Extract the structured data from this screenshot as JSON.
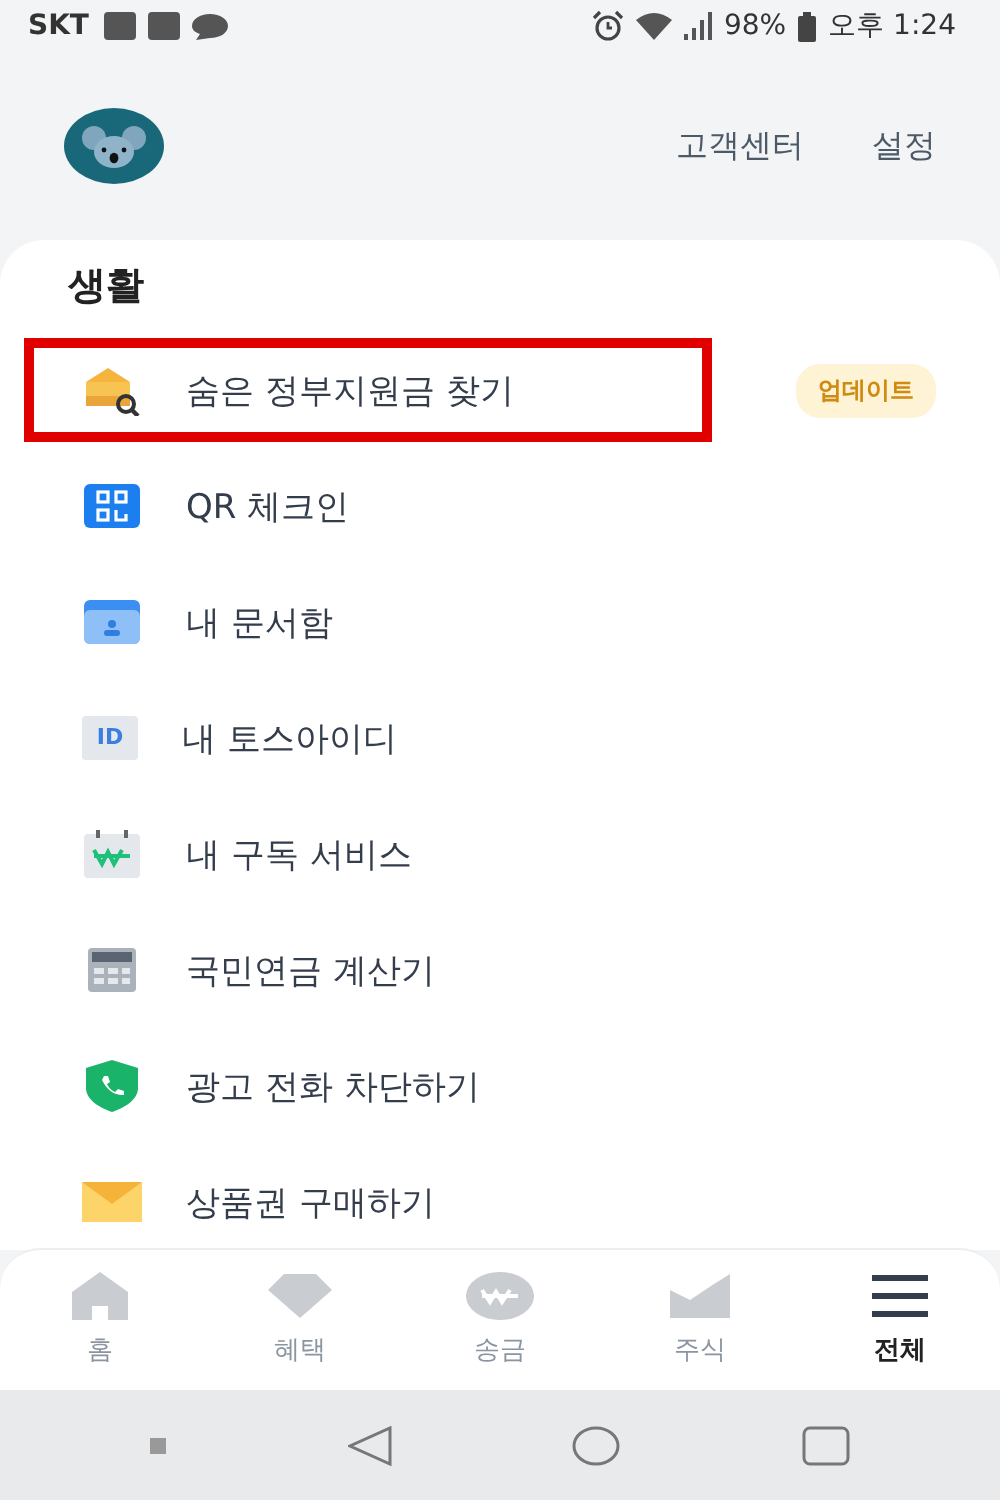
{
  "status_bar": {
    "carrier": "SKT",
    "battery": "98%",
    "time": "오후 1:24"
  },
  "header": {
    "links": [
      "고객센터",
      "설정"
    ]
  },
  "section": {
    "title": "생활",
    "items": [
      {
        "kind": "bank",
        "label": "숨은 정부지원금 찾기",
        "badge": "업데이트",
        "highlighted": true
      },
      {
        "kind": "qr",
        "label": "QR 체크인",
        "highlighted": false
      },
      {
        "kind": "folder",
        "label": "내 문서함",
        "highlighted": false
      },
      {
        "kind": "id",
        "label": "내 토스아이디",
        "icon_text": "ID",
        "highlighted": false
      },
      {
        "kind": "calendar",
        "label": "내 구독 서비스",
        "highlighted": false
      },
      {
        "kind": "calculator",
        "label": "국민연금 계산기",
        "highlighted": false
      },
      {
        "kind": "shield",
        "label": "광고 전화 차단하기",
        "highlighted": false
      },
      {
        "kind": "envelope",
        "label": "상품권 구매하기",
        "highlighted": false
      }
    ]
  },
  "tab_bar": [
    {
      "kind": "home",
      "label": "홈",
      "selected": false
    },
    {
      "kind": "gem",
      "label": "혜택",
      "selected": false
    },
    {
      "kind": "send",
      "label": "송금",
      "selected": false
    },
    {
      "kind": "stock",
      "label": "주식",
      "selected": false
    },
    {
      "kind": "menu",
      "label": "전체",
      "selected": true
    }
  ]
}
